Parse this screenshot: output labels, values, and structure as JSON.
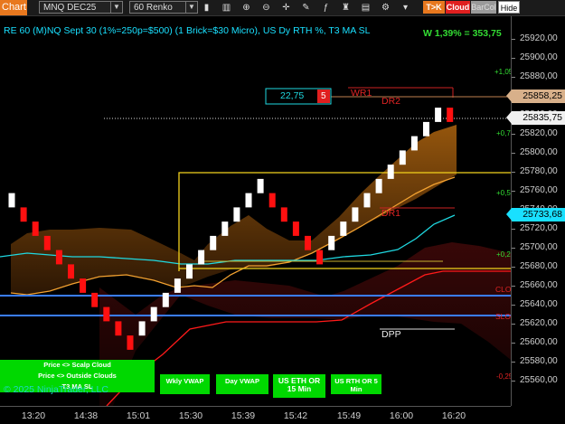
{
  "toolbar": {
    "tab_label": "Chart",
    "instrument": "MNQ DEC25",
    "bar_type": "60 Renko",
    "tock_label": "T>K",
    "cloud_label": "Cloud",
    "barcol_label": "BarCol",
    "hide_label": "Hide"
  },
  "chart_title": "RE 60 (M)NQ Sept 30 (1%=250p=$500) (1 Brick=$30 Micro), US Dy RTH %, T3 MA SL",
  "stat": "W 1,39% = 353,75",
  "box_value": "22,75",
  "box_count": "5",
  "labels": {
    "wr1": "WR1",
    "dr2": "DR2",
    "dr1": "DR1",
    "dpp": "DPP",
    "clo": "CLO",
    "slo": "SLO",
    "pct_p105": "+1,05",
    "pct_p075": "+0,75",
    "pct_p05": "+0,5",
    "pct_p025": "+0,25",
    "pct_m025": "-0,25"
  },
  "price_ticks": [
    "25920,00",
    "25900,00",
    "25880,00",
    "25860,00",
    "25840,00",
    "25820,00",
    "25800,00",
    "25780,00",
    "25760,00",
    "25740,00",
    "25720,00",
    "25700,00",
    "25680,00",
    "25660,00",
    "25640,00",
    "25620,00",
    "25600,00",
    "25580,00",
    "25560,00"
  ],
  "price_tags": {
    "high": "25858,25",
    "last": "25835,75",
    "low": "25733,68"
  },
  "time_labels": [
    "13:20",
    "14:38",
    "15:01",
    "15:30",
    "15:39",
    "15:42",
    "15:49",
    "16:00",
    "16:20"
  ],
  "panel_buttons": [
    "Price <> Scalp Cloud",
    "Price <> Outside Clouds",
    "T3 MA SL"
  ],
  "study_buttons": [
    "Wkly VWAP",
    "Day VWAP",
    "US ETH OR 15 Min",
    "US RTH OR 5 Min"
  ],
  "copyright": "© 2025 NinjaTrader, LLC",
  "colors": {
    "bull": "#ffffff",
    "bear": "#ff1010",
    "accent": "#e8781e",
    "cyan": "#19e0ff",
    "green": "#00d800",
    "yellow": "#f2d21c"
  },
  "chart_data": {
    "type": "renko",
    "brick_size": 15,
    "bricks": [
      {
        "dir": "up",
        "open": 25742.5,
        "close": 25757.5
      },
      {
        "dir": "down",
        "open": 25742.5,
        "close": 25727.5
      },
      {
        "dir": "down",
        "open": 25727.5,
        "close": 25712.5
      },
      {
        "dir": "down",
        "open": 25712.5,
        "close": 25697.5
      },
      {
        "dir": "down",
        "open": 25697.5,
        "close": 25682.5
      },
      {
        "dir": "down",
        "open": 25682.5,
        "close": 25667.5
      },
      {
        "dir": "down",
        "open": 25667.5,
        "close": 25652.5
      },
      {
        "dir": "down",
        "open": 25652.5,
        "close": 25637.5
      },
      {
        "dir": "down",
        "open": 25637.5,
        "close": 25622.5
      },
      {
        "dir": "down",
        "open": 25622.5,
        "close": 25607.5
      },
      {
        "dir": "down",
        "open": 25607.5,
        "close": 25592.5
      },
      {
        "dir": "up",
        "open": 25607.5,
        "close": 25622.5
      },
      {
        "dir": "up",
        "open": 25622.5,
        "close": 25637.5
      },
      {
        "dir": "up",
        "open": 25637.5,
        "close": 25652.5
      },
      {
        "dir": "up",
        "open": 25652.5,
        "close": 25667.5
      },
      {
        "dir": "up",
        "open": 25667.5,
        "close": 25682.5
      },
      {
        "dir": "up",
        "open": 25682.5,
        "close": 25697.5
      },
      {
        "dir": "up",
        "open": 25697.5,
        "close": 25712.5
      },
      {
        "dir": "up",
        "open": 25712.5,
        "close": 25727.5
      },
      {
        "dir": "up",
        "open": 25727.5,
        "close": 25742.5
      },
      {
        "dir": "up",
        "open": 25742.5,
        "close": 25757.5
      },
      {
        "dir": "up",
        "open": 25757.5,
        "close": 25772.5
      },
      {
        "dir": "down",
        "open": 25757.5,
        "close": 25742.5
      },
      {
        "dir": "down",
        "open": 25742.5,
        "close": 25727.5
      },
      {
        "dir": "down",
        "open": 25727.5,
        "close": 25712.5
      },
      {
        "dir": "down",
        "open": 25712.5,
        "close": 25697.5
      },
      {
        "dir": "down",
        "open": 25697.5,
        "close": 25682.5
      },
      {
        "dir": "up",
        "open": 25697.5,
        "close": 25712.5
      },
      {
        "dir": "up",
        "open": 25712.5,
        "close": 25727.5
      },
      {
        "dir": "up",
        "open": 25727.5,
        "close": 25742.5
      },
      {
        "dir": "up",
        "open": 25742.5,
        "close": 25757.5
      },
      {
        "dir": "up",
        "open": 25757.5,
        "close": 25772.5
      },
      {
        "dir": "up",
        "open": 25772.5,
        "close": 25787.5
      },
      {
        "dir": "up",
        "open": 25787.5,
        "close": 25802.5
      },
      {
        "dir": "up",
        "open": 25802.5,
        "close": 25817.5
      },
      {
        "dir": "up",
        "open": 25817.5,
        "close": 25832.5
      },
      {
        "dir": "up",
        "open": 25832.5,
        "close": 25847.5
      },
      {
        "dir": "down",
        "open": 25847.5,
        "close": 25832.5
      }
    ],
    "levels": {
      "wr1": 25862.0,
      "dr2": 25849.0,
      "dr1": 25742.0,
      "dpp": 25613.0,
      "clo": 25652.0,
      "slo": 25630.5,
      "last": 25835.75
    }
  }
}
